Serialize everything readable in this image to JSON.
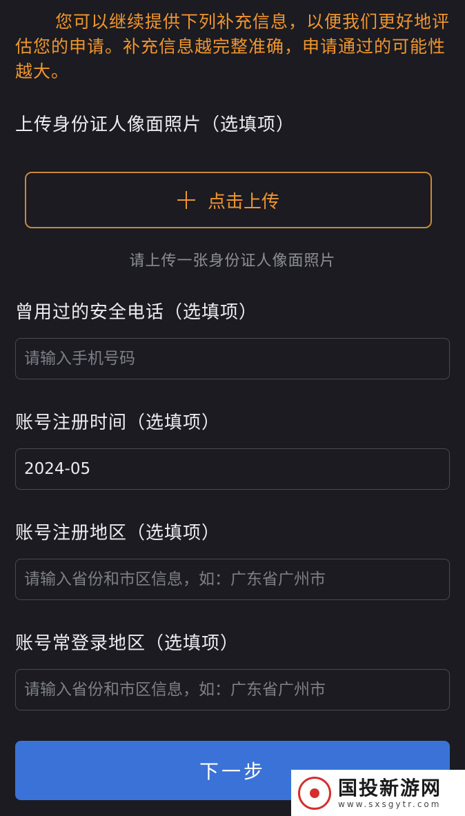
{
  "notice": "您可以继续提供下列补充信息，以便我们更好地评估您的申请。补充信息越完整准确，申请通过的可能性越大。",
  "id_photo": {
    "label": "上传身份证人像面照片（选填项）",
    "upload_button": "点击上传",
    "hint": "请上传一张身份证人像面照片"
  },
  "phone": {
    "label": "曾用过的安全电话（选填项）",
    "placeholder": "请输入手机号码",
    "value": ""
  },
  "register_time": {
    "label": "账号注册时间（选填项）",
    "value": "2024-05"
  },
  "register_region": {
    "label": "账号注册地区（选填项）",
    "placeholder": "请输入省份和市区信息，如：广东省广州市",
    "value": ""
  },
  "frequent_region": {
    "label": "账号常登录地区（选填项）",
    "placeholder": "请输入省份和市区信息，如：广东省广州市",
    "value": ""
  },
  "next_button": "下一步",
  "watermark": {
    "title": "国投新游网",
    "url": "www.sxsgytr.com"
  },
  "colors": {
    "background": "#1b1b21",
    "accent_orange": "#f0962e",
    "primary_blue": "#3a72d8"
  }
}
